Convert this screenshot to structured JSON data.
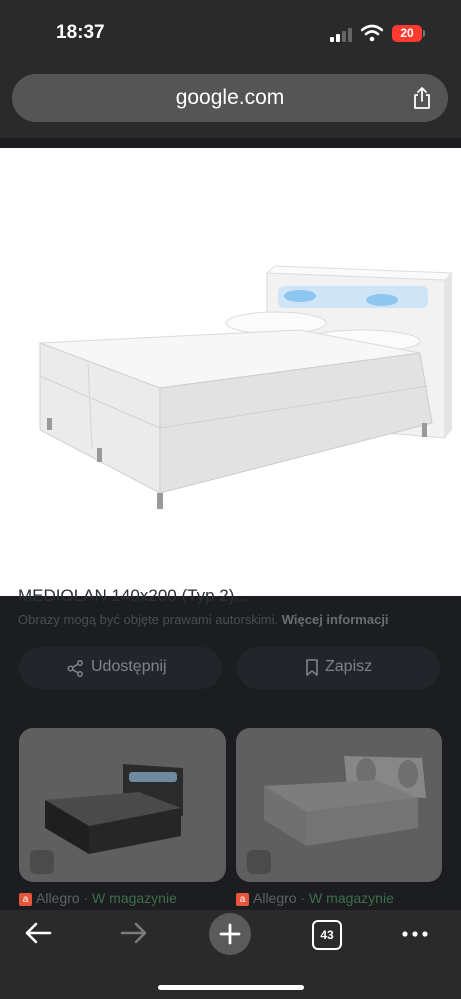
{
  "status_bar": {
    "time": "18:37",
    "battery": "20",
    "battery_color": "#ff3b30"
  },
  "browser": {
    "url": "google.com",
    "tab_count": "43"
  },
  "image_viewer": {
    "partial_title": "MEDIOLAN 140x200 (Typ 2)...",
    "copyright_notice": "Obrazy mogą być objęte prawami autorskimi.",
    "more_info_link": "Więcej informacji",
    "share_label": "Udostępnij",
    "save_label": "Zapisz"
  },
  "related": [
    {
      "source": "Allegro",
      "availability": "W magazynie"
    },
    {
      "source": "Allegro",
      "availability": "W magazynie"
    }
  ],
  "colors": {
    "page_bg": "#1b1d21",
    "toolbar_bg": "#2a2a2a",
    "in_stock": "#3d6f4a"
  }
}
